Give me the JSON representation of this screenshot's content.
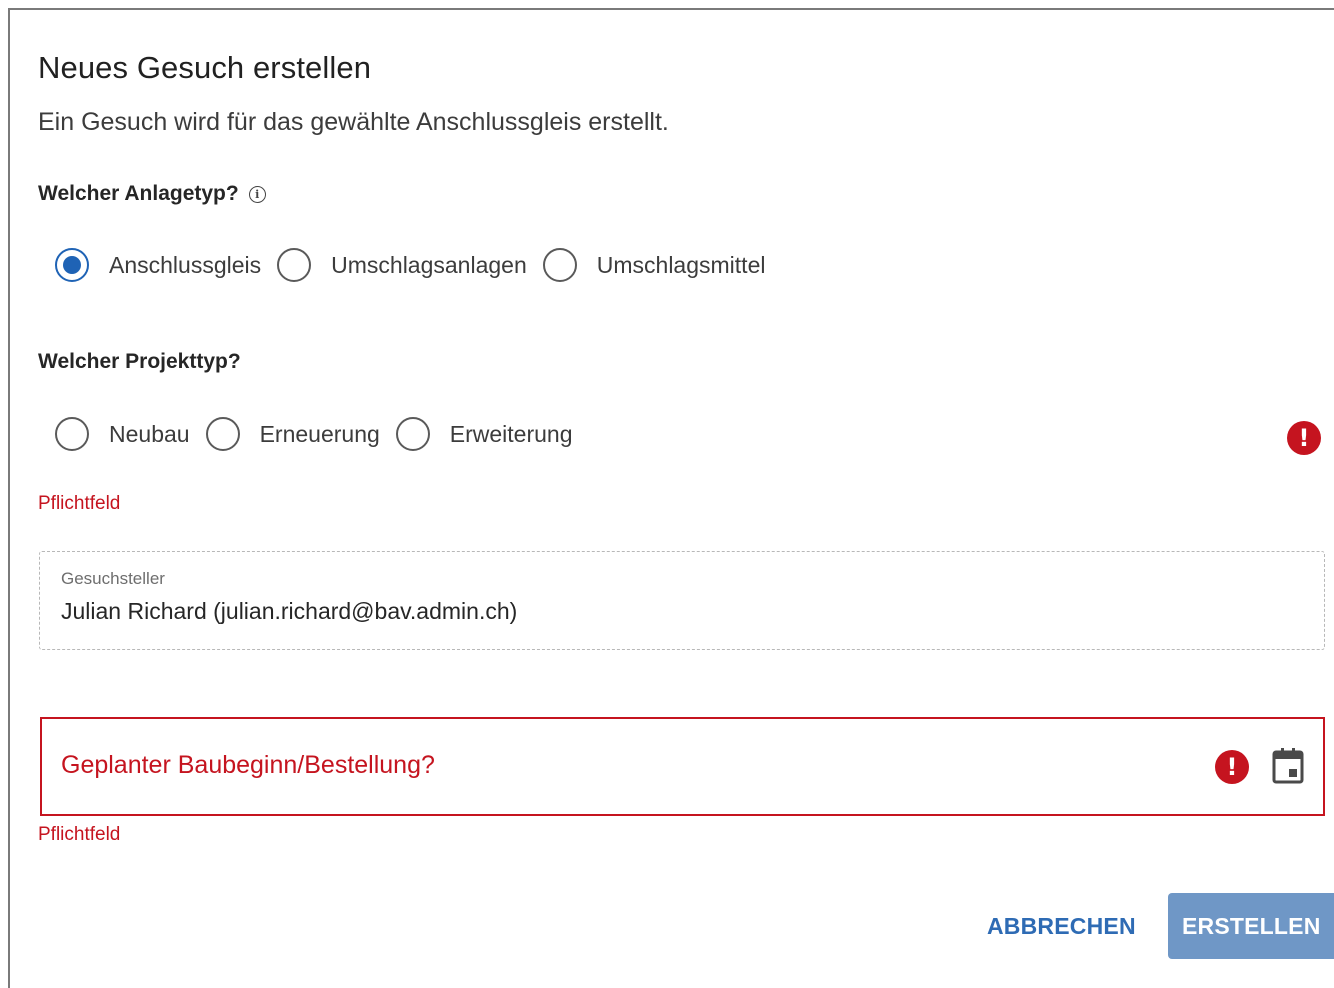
{
  "dialog": {
    "title": "Neues Gesuch erstellen",
    "subtitle": "Ein Gesuch wird für das gewählte Anschlussgleis erstellt."
  },
  "anlagetyp": {
    "question": "Welcher Anlagetyp?",
    "info_icon": "info-icon",
    "options": [
      "Anschlussgleis",
      "Umschlagsanlagen",
      "Umschlagsmittel"
    ],
    "selected": "Anschlussgleis"
  },
  "projekttyp": {
    "question": "Welcher Projekttyp?",
    "options": [
      "Neubau",
      "Erneuerung",
      "Erweiterung"
    ],
    "selected": null,
    "error_icon": "exclamation-circle-icon",
    "error": "Pflichtfeld"
  },
  "gesuchsteller": {
    "label": "Gesuchsteller",
    "value": "Julian Richard (julian.richard@bav.admin.ch)"
  },
  "baubeginn": {
    "placeholder": "Geplanter Baubeginn/Bestellung?",
    "error_icon": "exclamation-circle-icon",
    "calendar_icon": "calendar-icon",
    "error": "Pflichtfeld"
  },
  "actions": {
    "cancel_label": "ABBRECHEN",
    "submit_label": "ERSTELLEN"
  },
  "colors": {
    "primary": "#1f63b5",
    "error": "#c5141f",
    "button_disabled": "#6f97c6"
  }
}
